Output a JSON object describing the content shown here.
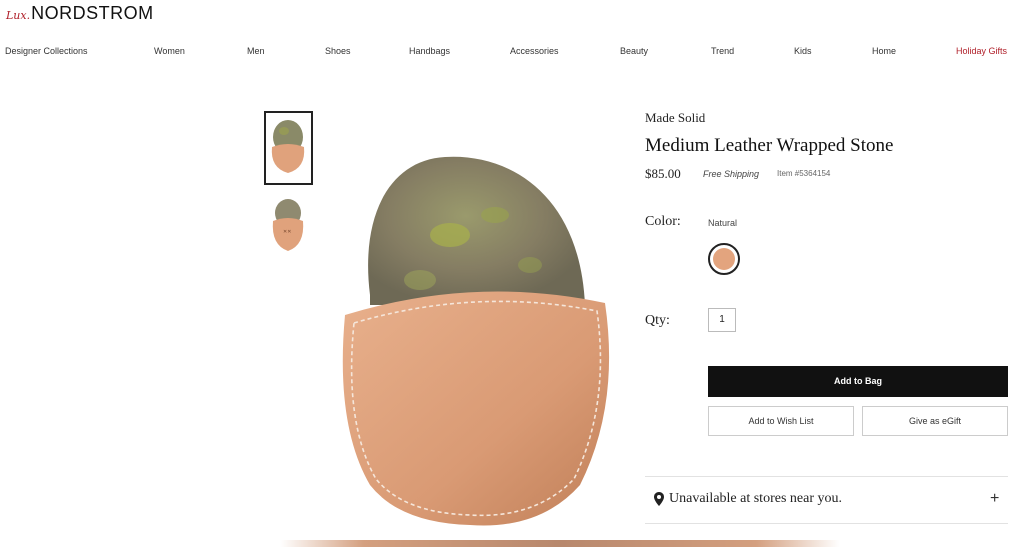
{
  "header": {
    "logo_script": "Lux.",
    "logo_word": "NORDSTROM"
  },
  "nav": {
    "items": [
      "Designer Collections",
      "Women",
      "Men",
      "Shoes",
      "Handbags",
      "Accessories",
      "Beauty",
      "Trend",
      "Kids",
      "Home",
      "Holiday Gifts"
    ]
  },
  "product": {
    "brand": "Made Solid",
    "title": "Medium Leather Wrapped Stone",
    "price": "$85.00",
    "shipping": "Free Shipping",
    "item_number": "Item #5364154",
    "color_label": "Color:",
    "color_value": "Natural",
    "swatch_color": "#e3a47e",
    "qty_label": "Qty:",
    "qty_value": "1"
  },
  "actions": {
    "add_to_bag": "Add to Bag",
    "add_to_wishlist": "Add to Wish List",
    "give_egift": "Give as eGift"
  },
  "availability": {
    "text": "Unavailable at stores near you.",
    "expand": "+"
  },
  "icons": {
    "location": "map-pin-icon",
    "expand": "plus-icon"
  }
}
